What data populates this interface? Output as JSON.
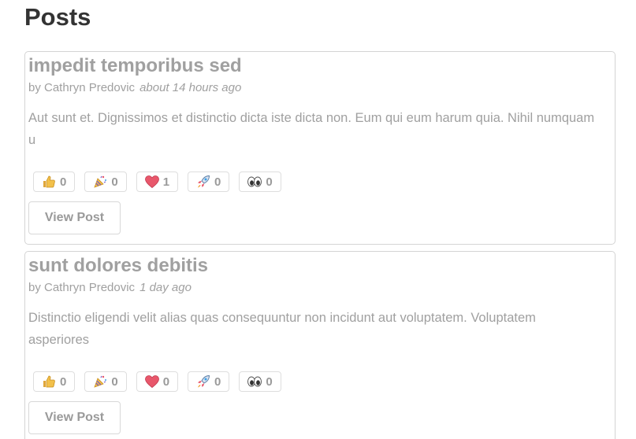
{
  "page": {
    "title": "Posts"
  },
  "posts": [
    {
      "title": "impedit temporibus sed",
      "byline_prefix": "by Cathryn Predovic",
      "time": "about 14 hours ago",
      "excerpt": "Aut sunt et. Dignissimos et distinctio dicta iste dicta non. Eum qui eum harum quia. Nihil numquam u",
      "reactions": [
        {
          "icon": "thumbs-up-icon",
          "count": "0"
        },
        {
          "icon": "party-popper-icon",
          "count": "0"
        },
        {
          "icon": "heart-icon",
          "count": "1"
        },
        {
          "icon": "rocket-icon",
          "count": "0"
        },
        {
          "icon": "eyes-icon",
          "count": "0"
        }
      ],
      "view_label": "View Post"
    },
    {
      "title": "sunt dolores debitis",
      "byline_prefix": "by Cathryn Predovic",
      "time": "1 day ago",
      "excerpt": "Distinctio eligendi velit alias quas consequuntur non incidunt aut voluptatem. Voluptatem asperiores",
      "reactions": [
        {
          "icon": "thumbs-up-icon",
          "count": "0"
        },
        {
          "icon": "party-popper-icon",
          "count": "0"
        },
        {
          "icon": "heart-icon",
          "count": "0"
        },
        {
          "icon": "rocket-icon",
          "count": "0"
        },
        {
          "icon": "eyes-icon",
          "count": "0"
        }
      ],
      "view_label": "View Post"
    }
  ],
  "colors": {
    "title": "#333333",
    "muted_text": "#a0a0a0",
    "border": "#d4d4d4",
    "heart": "#e8576b",
    "thumb": "#f2c04a"
  }
}
